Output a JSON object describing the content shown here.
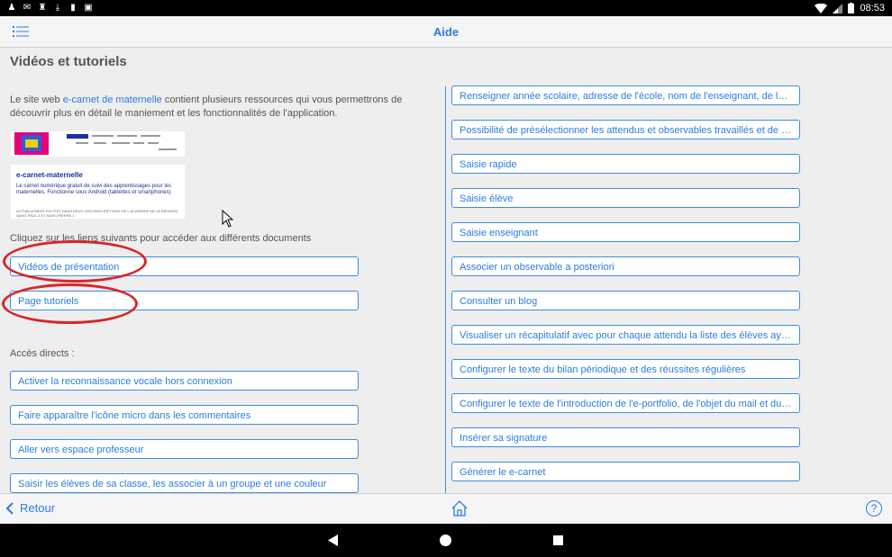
{
  "statusbar": {
    "time": "08:53"
  },
  "appbar": {
    "title": "Aide"
  },
  "main": {
    "heading": "Vidéos et tutoriels",
    "intro_pre": "Le site web ",
    "intro_link": "e-carnet de maternelle",
    "intro_post": " contient plusieurs ressources qui vous permettrons de découvrir plus en détail le maniement et les fonctionnalités de l'application.",
    "thumbnail": {
      "title": "e-carnet-maternelle",
      "lines": "Le carnet numérique gratuit de suivi des apprentissages pour les maternelles. Fonctionne sous Android (tablettes et smartphones)",
      "small": "ACTUELLEMENT EN TEST DANS DEUX CIRCONSCRIPTIONS DE L'ACADÉMIE DE LA RÉUNION SAINT-PAUL 3 ET SAINT-PIERRE 1"
    },
    "links_label": "Cliquez sur les liens suivants pour accéder aux différents documents",
    "videos_button": "Vidéos de présentation",
    "tutorials_button": "Page tutoriels",
    "direct_label": "Accès directs :",
    "left_buttons": [
      "Activer la reconnaissance vocale hors connexion",
      "Faire apparaître l'icône micro dans les commentaires",
      "Aller vers espace professeur",
      "Saisir les élèves de sa classe, les associer à un groupe et une couleur"
    ],
    "right_buttons": [
      "Renseigner année scolaire, adresse de l'école, nom de l'enseignant, de la cl...",
      "Possibilité de présélectionner les attendus et observables travaillés et de s...",
      "Saisie rapide",
      "Saisie élève",
      "Saisie enseignant",
      "Associer un observable a posteriori",
      "Consulter un blog",
      "Visualiser un récapitulatif avec pour chaque attendu la liste des élèves ayan...",
      "Configurer le texte du bilan périodique et des réussites régulières",
      "Configurer le texte de l'introduction de l'e-portfolio, de l'objet du mail et du c...",
      "Insérer sa signature",
      "Générer le e-carnet"
    ]
  },
  "bottombar": {
    "back_label": "Retour",
    "help_label": "?"
  },
  "colors": {
    "accent": "#2a7de1",
    "annotation": "#d7262a"
  }
}
